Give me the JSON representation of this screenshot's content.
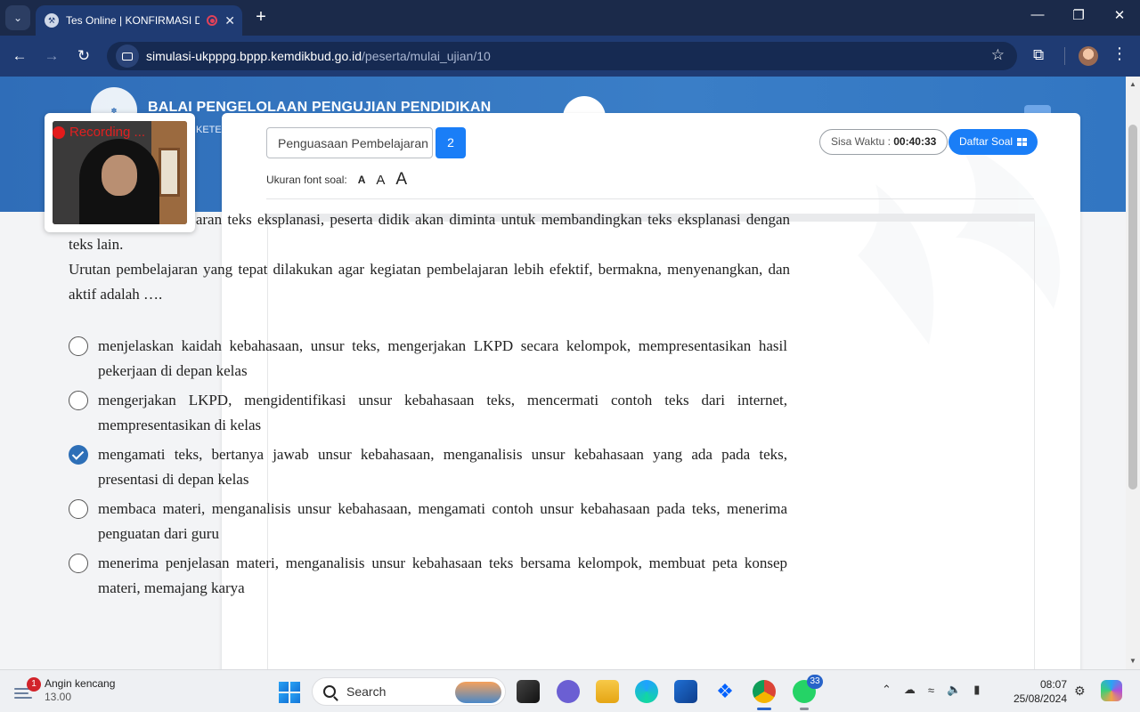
{
  "browser": {
    "tab_title": "Tes Online | KONFIRMASI D",
    "url_domain": "simulasi-ukpppg.bppp.kemdikbud.go.id",
    "url_path": "/peserta/mulai_ujian/10"
  },
  "banner": {
    "title": "BALAI PENGELOLAAN PENGUJIAN PENDIDIKAN",
    "subtitle": "KETER"
  },
  "recording": {
    "label": "Recording ..."
  },
  "exam": {
    "subject": "Penguasaan Pembelajaran",
    "question_number": "2",
    "font_label": "Ukuran font soal:",
    "font_sizes": [
      "A",
      "A",
      "A"
    ],
    "timer_label": "Sisa Waktu : ",
    "timer_value": "00:40:33",
    "soal_button": "Daftar Soal",
    "question_text": "Pada akhir pembelajaran teks eksplanasi, peserta didik akan diminta untuk membandingkan teks eksplanasi dengan teks lain.",
    "question_prompt": "Urutan pembelajaran yang tepat dilakukan agar kegiatan pembelajaran lebih efektif, bermakna, menyenangkan, dan aktif adalah ….",
    "options": [
      {
        "text": "menjelaskan kaidah kebahasaan, unsur teks, mengerjakan LKPD secara kelompok, mempresentasikan hasil pekerjaan di depan kelas",
        "selected": false
      },
      {
        "text": "mengerjakan LKPD, mengidentifikasi unsur kebahasaan teks, mencermati contoh teks dari internet, mempresentasikan di kelas",
        "selected": false
      },
      {
        "text": "mengamati teks, bertanya jawab unsur kebahasaan, menganalisis unsur kebahasaan yang ada pada teks, presentasi di depan kelas",
        "selected": true
      },
      {
        "text": "membaca materi, menganalisis unsur kebahasaan, mengamati contoh unsur kebahasaan pada teks, menerima penguatan dari guru",
        "selected": false
      },
      {
        "text": "menerima penjelasan materi, menganalisis unsur kebahasaan teks bersama kelompok, membuat peta konsep materi, memajang karya",
        "selected": false
      }
    ]
  },
  "taskbar": {
    "weather_badge": "1",
    "weather_title": "Angin kencang",
    "weather_time": "13.00",
    "search_label": "Search",
    "whatsapp_badge": "33",
    "clock_time": "08:07",
    "clock_date": "25/08/2024"
  },
  "colors": {
    "tab_bar": "#1b2a4a",
    "toolbar": "#1f3b73",
    "banner": "#2f6db8",
    "primary_button": "#1a7ef7",
    "selected_radio": "#2d6fb7",
    "recording_red": "#e31b1b"
  }
}
